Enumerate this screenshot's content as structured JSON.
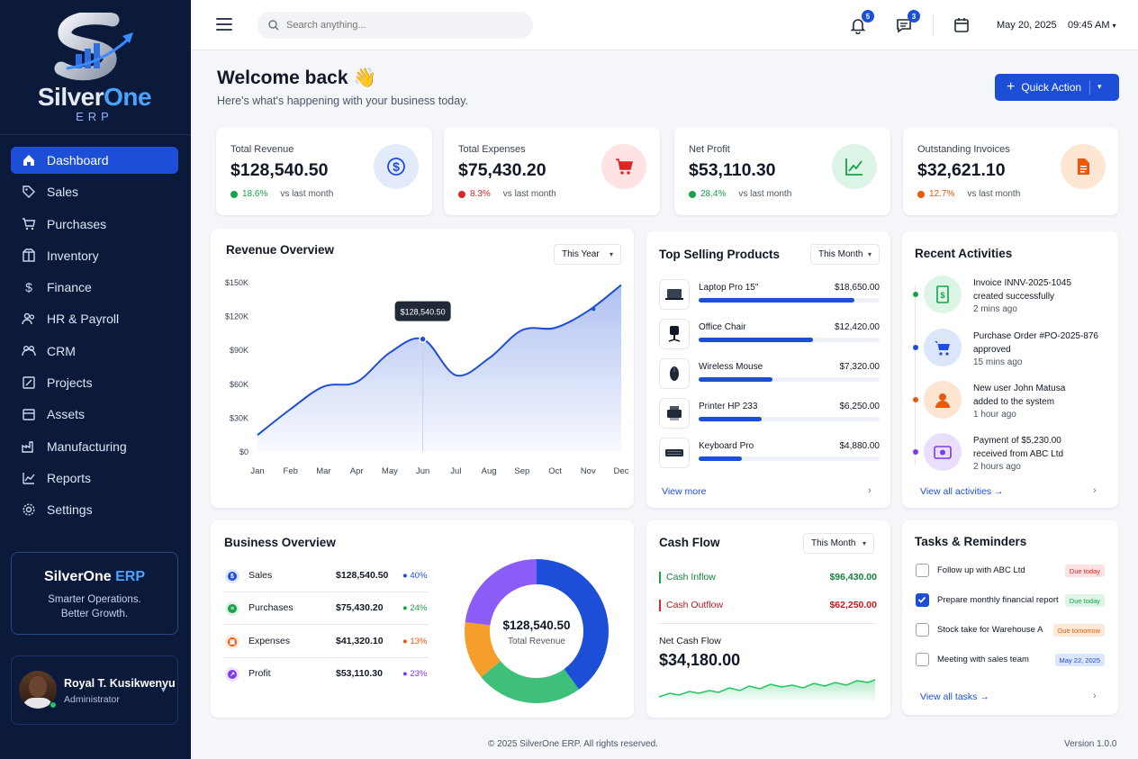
{
  "app": {
    "name_part1": "SilverOne",
    "name_part2": "ERP",
    "logo_sub": "ERP"
  },
  "sidebar": {
    "items": [
      {
        "label": "Dashboard",
        "icon": "home-icon",
        "active": true
      },
      {
        "label": "Sales",
        "icon": "tag-icon"
      },
      {
        "label": "Purchases",
        "icon": "cart-icon"
      },
      {
        "label": "Inventory",
        "icon": "box-icon"
      },
      {
        "label": "Finance",
        "icon": "dollar-icon"
      },
      {
        "label": "HR & Payroll",
        "icon": "people-icon"
      },
      {
        "label": "CRM",
        "icon": "users-icon"
      },
      {
        "label": "Projects",
        "icon": "edit-icon"
      },
      {
        "label": "Assets",
        "icon": "cube-icon"
      },
      {
        "label": "Manufacturing",
        "icon": "factory-icon"
      },
      {
        "label": "Reports",
        "icon": "chart-icon"
      },
      {
        "label": "Settings",
        "icon": "gear-icon"
      }
    ],
    "promo": {
      "title_part1": "SilverOne",
      "title_part2": "ERP",
      "line1": "Smarter Operations.",
      "line2": "Better Growth."
    },
    "user": {
      "name": "Royal T. Kusikwenyu",
      "role": "Administrator"
    }
  },
  "topbar": {
    "search_placeholder": "Search anything...",
    "notifications_count": "5",
    "messages_count": "3",
    "date": "May 20, 2025",
    "time": "09:45 AM"
  },
  "header": {
    "welcome": "Welcome back 👋",
    "subtitle": "Here's what's happening with your business today.",
    "quick_action": "Quick Action"
  },
  "kpis": [
    {
      "label": "Total Revenue",
      "value": "$128,540.50",
      "change": "18.6%",
      "vs": "vs last month",
      "color": "#16a34a"
    },
    {
      "label": "Total Expenses",
      "value": "$75,430.20",
      "change": "8.3%",
      "vs": "vs last month",
      "color": "#dc2626"
    },
    {
      "label": "Net Profit",
      "value": "$53,110.30",
      "change": "28.4%",
      "vs": "vs last month",
      "color": "#16a34a"
    },
    {
      "label": "Outstanding Invoices",
      "value": "$32,621.10",
      "change": "12.7%",
      "vs": "vs last month",
      "color": "#ea580c"
    }
  ],
  "revenue_overview": {
    "title": "Revenue Overview",
    "period": "This Year",
    "tooltip": "$128,540.50"
  },
  "chart_data": {
    "type": "area",
    "x": [
      "Jan",
      "Feb",
      "Mar",
      "Apr",
      "May",
      "Jun",
      "Jul",
      "Aug",
      "Sep",
      "Oct",
      "Nov",
      "Dec"
    ],
    "y_ticks": [
      "$0",
      "$30K",
      "$60K",
      "$90K",
      "$120K",
      "$150K"
    ],
    "ylim": [
      0,
      150000
    ],
    "series": [
      {
        "values": [
          15000,
          38000,
          58000,
          62000,
          88000,
          100000,
          68000,
          83000,
          108000,
          110000,
          125000,
          148000
        ]
      }
    ],
    "highlight": {
      "x": "Jun",
      "label": "$128,540.50"
    },
    "color": "#1d4ed8"
  },
  "top_products": {
    "title": "Top Selling Products",
    "period": "This Month",
    "items": [
      {
        "name": "Laptop Pro 15\"",
        "value": "$18,650.00",
        "pct": 0.86
      },
      {
        "name": "Office Chair",
        "value": "$12,420.00",
        "pct": 0.63
      },
      {
        "name": "Wireless Mouse",
        "value": "$7,320.00",
        "pct": 0.41
      },
      {
        "name": "Printer HP 233",
        "value": "$6,250.00",
        "pct": 0.35
      },
      {
        "name": "Keyboard Pro",
        "value": "$4,880.00",
        "pct": 0.24
      }
    ],
    "view_more": "View more"
  },
  "activities": {
    "title": "Recent Activities",
    "items": [
      {
        "line1": "Invoice INNV-2025-1045",
        "line2": "created successfully",
        "time": "2 mins ago",
        "color": "#16a34a",
        "bg": "#dcf5e6"
      },
      {
        "line1": "Purchase Order #PO-2025-876",
        "line2": "approved",
        "time": "15 mins ago",
        "color": "#1d4ed8",
        "bg": "#dbe6fb"
      },
      {
        "line1": "New user John Matusa",
        "line2": "added to the system",
        "time": "1 hour ago",
        "color": "#ea580c",
        "bg": "#fde5d2"
      },
      {
        "line1": "Payment of $5,230.00",
        "line2": "received from ABC Ltd",
        "time": "2 hours ago",
        "color": "#7c3aed",
        "bg": "#e9dffc"
      }
    ],
    "view_all": "View all activities"
  },
  "business_overview": {
    "title": "Business Overview",
    "rows": [
      {
        "name": "Sales",
        "value": "$128,540.50",
        "pct": "40%",
        "color": "#1d4ed8"
      },
      {
        "name": "Purchases",
        "value": "$75,430.20",
        "pct": "24%",
        "color": "#16a34a"
      },
      {
        "name": "Expenses",
        "value": "$41,320.10",
        "pct": "13%",
        "color": "#ea580c"
      },
      {
        "name": "Profit",
        "value": "$53,110.30",
        "pct": "23%",
        "color": "#7c3aed"
      }
    ],
    "donut_value": "$128,540.50",
    "donut_label": "Total Revenue"
  },
  "cash_flow": {
    "title": "Cash Flow",
    "period": "This Month",
    "inflow_label": "Cash Inflow",
    "inflow_value": "$96,430.00",
    "outflow_label": "Cash Outflow",
    "outflow_value": "$62,250.00",
    "net_label": "Net Cash Flow",
    "net_value": "$34,180.00"
  },
  "tasks": {
    "title": "Tasks & Reminders",
    "items": [
      {
        "text": "Follow up with ABC Ltd",
        "badge": "Due today",
        "checked": false,
        "fg": "#dc2626",
        "bg": "#fde2e2"
      },
      {
        "text": "Prepare monthly financial report",
        "badge": "Due today",
        "checked": true,
        "fg": "#16a34a",
        "bg": "#dcf5e6"
      },
      {
        "text": "Stock take for Warehouse A",
        "badge": "Due tomorrow",
        "checked": false,
        "fg": "#ea580c",
        "bg": "#fde9d6"
      },
      {
        "text": "Meeting with sales team",
        "badge": "May 22, 2025",
        "checked": false,
        "fg": "#1d4ed8",
        "bg": "#dbe6fb"
      }
    ],
    "view_all": "View all tasks"
  },
  "footer": {
    "copyright": "© 2025 SilverOne ERP. All rights reserved.",
    "version": "Version 1.0.0"
  }
}
